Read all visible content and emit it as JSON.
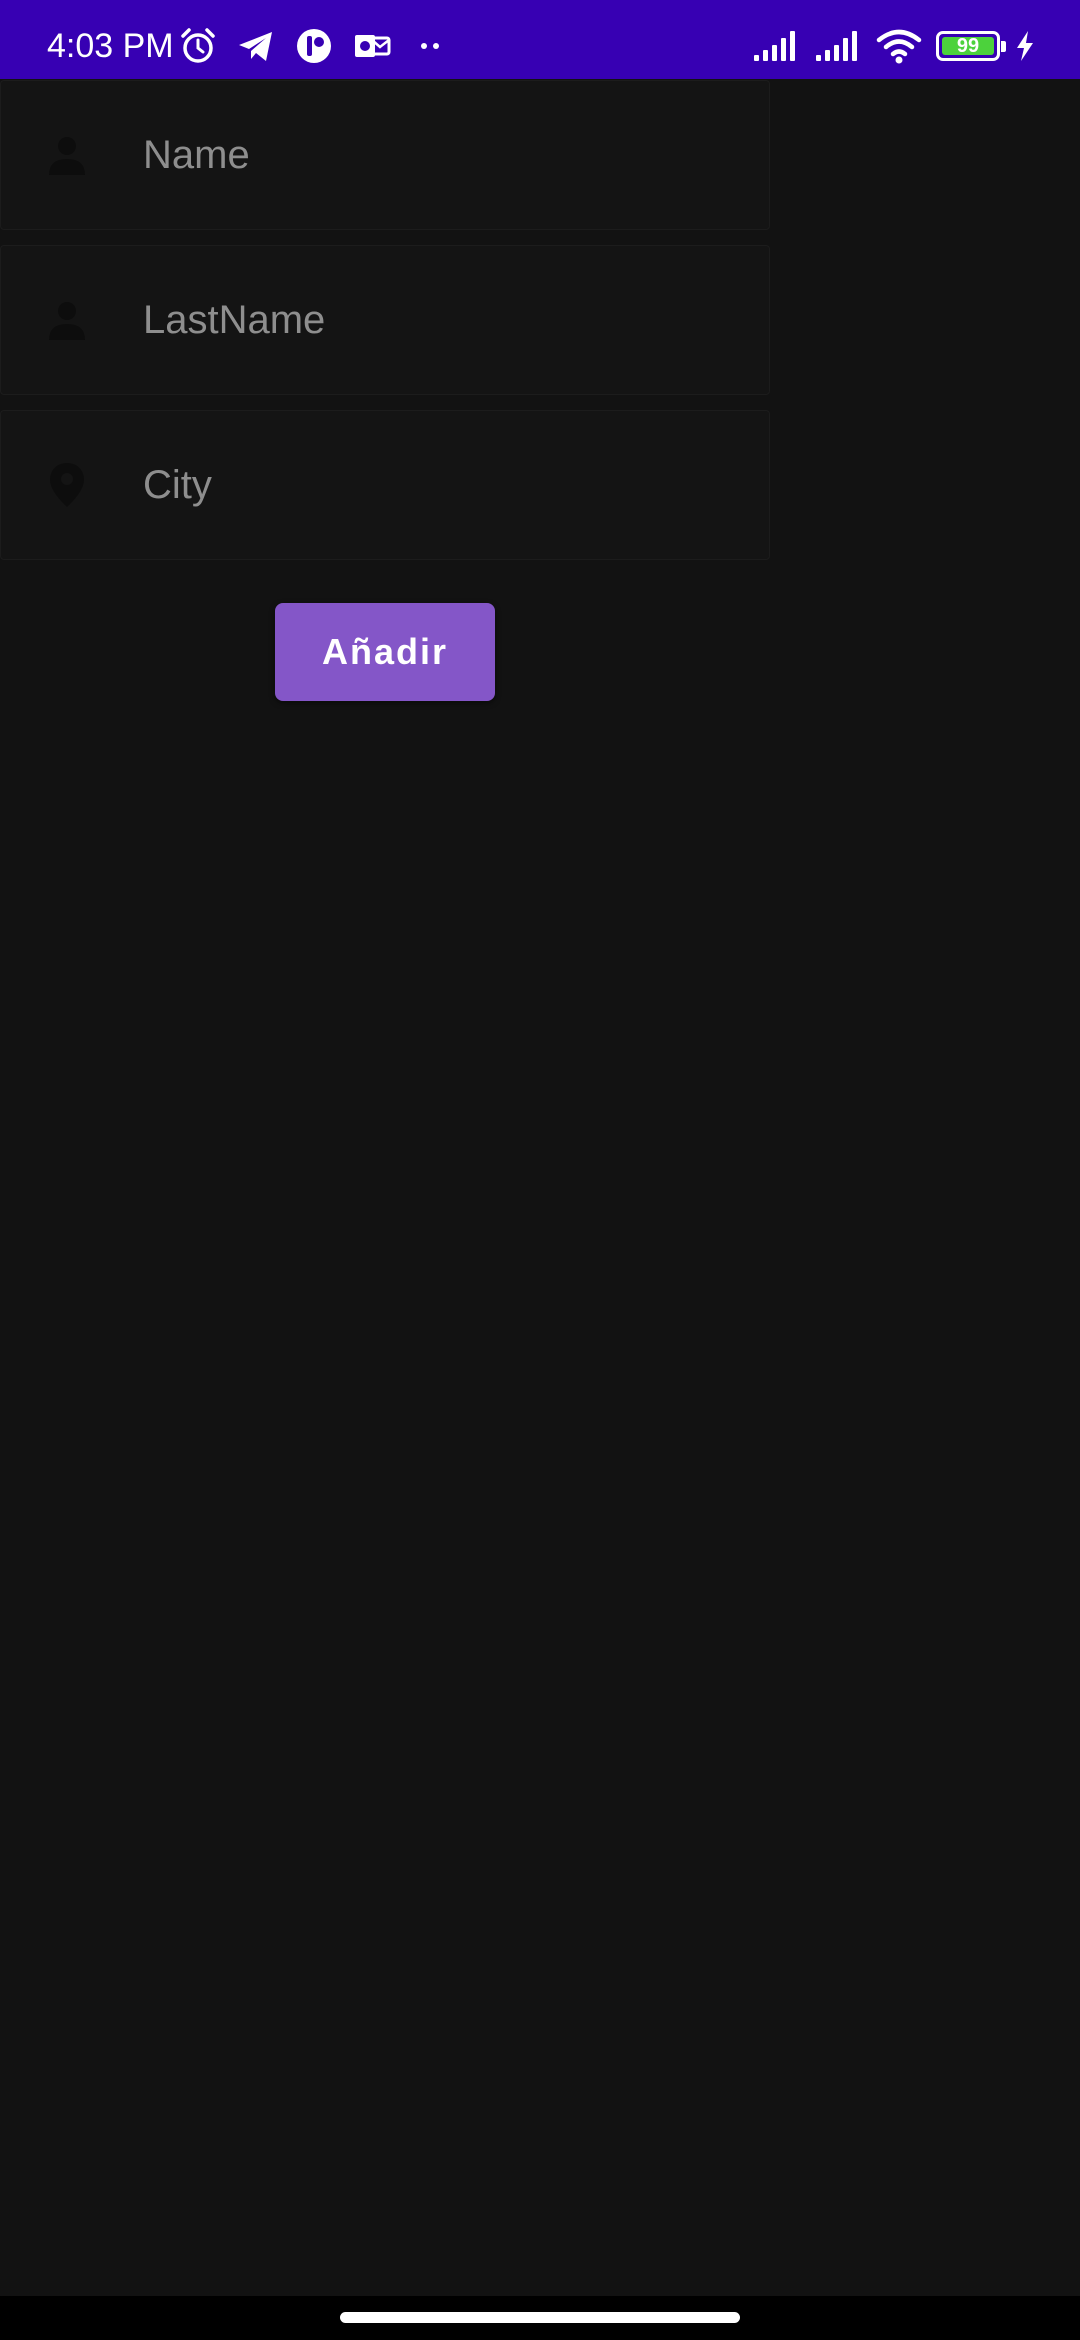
{
  "status_bar": {
    "time": "4:03 PM",
    "battery_level": "99",
    "colors": {
      "background": "#3700B3",
      "battery_fill": "#4CD23C"
    },
    "icons_left": [
      "alarm-icon",
      "telegram-icon",
      "notification-app-icon",
      "outlook-icon",
      "more-dots-icon"
    ],
    "icons_right": [
      "signal-icon",
      "signal-icon",
      "wifi-icon",
      "battery-icon",
      "charging-icon"
    ]
  },
  "form": {
    "fields": [
      {
        "placeholder": "Name",
        "value": "",
        "icon": "person-icon"
      },
      {
        "placeholder": "LastName",
        "value": "",
        "icon": "person-icon"
      },
      {
        "placeholder": "City",
        "value": "",
        "icon": "location-pin-icon"
      }
    ],
    "add_button_label": "Añadir",
    "colors": {
      "background": "#121212",
      "button": "#8456C8"
    }
  }
}
